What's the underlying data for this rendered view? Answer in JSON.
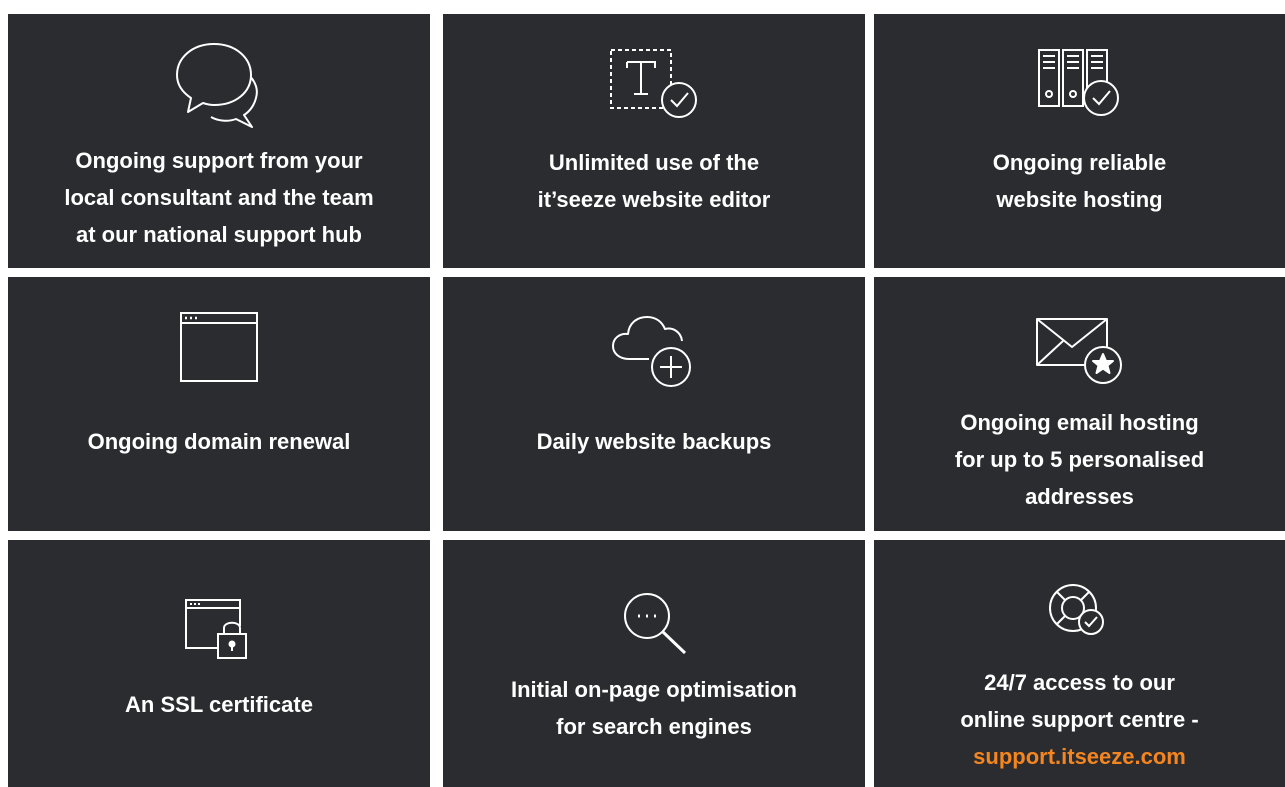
{
  "colors": {
    "card_bg": "#2b2c30",
    "text": "#ffffff",
    "accent": "#f5861f"
  },
  "features": [
    {
      "icon": "speech-bubbles-icon",
      "lines": [
        "Ongoing support from your",
        "local consultant and the team",
        "at our national support hub"
      ]
    },
    {
      "icon": "text-edit-check-icon",
      "lines": [
        "Unlimited use of the",
        "it’seeze website editor"
      ]
    },
    {
      "icon": "server-check-icon",
      "lines": [
        "Ongoing reliable",
        "website hosting"
      ]
    },
    {
      "icon": "browser-window-icon",
      "lines": [
        "Ongoing domain renewal"
      ]
    },
    {
      "icon": "cloud-add-icon",
      "lines": [
        "Daily website backups"
      ]
    },
    {
      "icon": "envelope-star-icon",
      "lines": [
        "Ongoing email hosting",
        "for up to 5 personalised",
        "addresses"
      ]
    },
    {
      "icon": "browser-padlock-icon",
      "lines": [
        "An SSL certificate"
      ]
    },
    {
      "icon": "magnifier-icon",
      "lines": [
        "Initial on-page optimisation",
        "for search engines"
      ]
    },
    {
      "icon": "lifebuoy-check-icon",
      "lines": [
        "24/7 access to our",
        "online support centre -"
      ],
      "link": "support.itseeze.com"
    }
  ]
}
